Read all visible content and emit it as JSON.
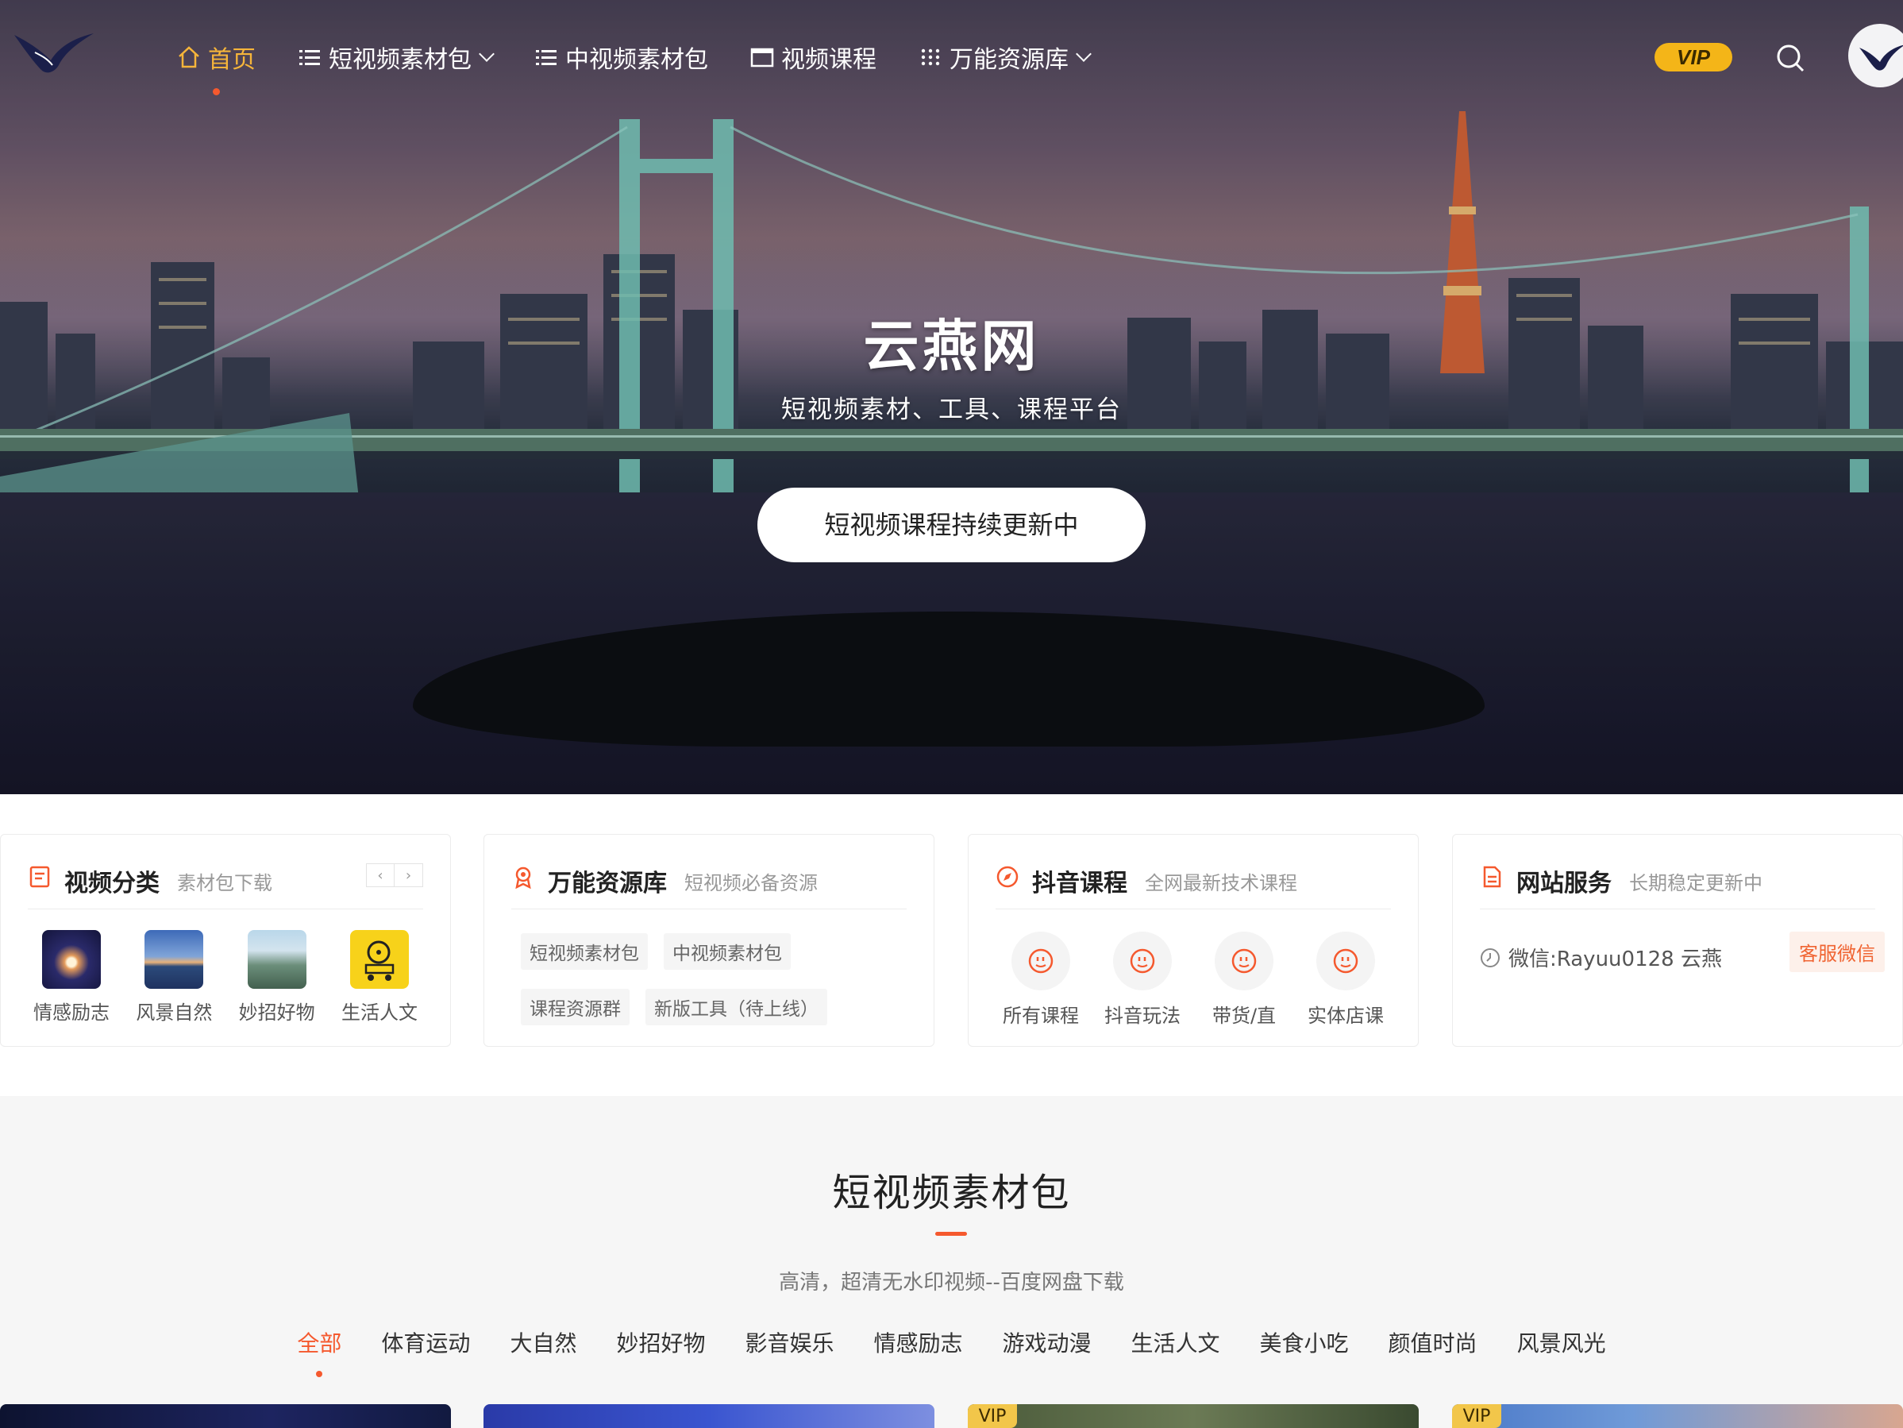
{
  "nav": {
    "items": [
      {
        "label": "首页",
        "active": true,
        "icon": "home-icon"
      },
      {
        "label": "短视频素材包",
        "icon": "list-icon",
        "dropdown": true
      },
      {
        "label": "中视频素材包",
        "icon": "list-icon"
      },
      {
        "label": "视频课程",
        "icon": "window-icon"
      },
      {
        "label": "万能资源库",
        "icon": "grid-icon",
        "dropdown": true
      }
    ],
    "vip_label": "VIP"
  },
  "hero": {
    "title": "云燕网",
    "subtitle": "短视频素材、工具、课程平台",
    "button": "短视频课程持续更新中"
  },
  "cards": {
    "video_category": {
      "title": "视频分类",
      "subtitle": "素材包下载",
      "items": [
        {
          "label": "情感励志"
        },
        {
          "label": "风景自然"
        },
        {
          "label": "妙招好物"
        },
        {
          "label": "生活人文"
        }
      ]
    },
    "resource": {
      "title": "万能资源库",
      "subtitle": "短视频必备资源",
      "tags": [
        "短视频素材包",
        "中视频素材包",
        "课程资源群",
        "新版工具（待上线）"
      ]
    },
    "douyin": {
      "title": "抖音课程",
      "subtitle": "全网最新技术课程",
      "items": [
        {
          "label": "所有课程"
        },
        {
          "label": "抖音玩法"
        },
        {
          "label": "带货/直"
        },
        {
          "label": "实体店课"
        }
      ]
    },
    "service": {
      "title": "网站服务",
      "subtitle": "长期稳定更新中",
      "text": "微信:Rayuu0128 云燕",
      "button": "客服微信"
    }
  },
  "section": {
    "title": "短视频素材包",
    "subtitle": "高清，超清无水印视频--百度网盘下载",
    "filters": [
      "全部",
      "体育运动",
      "大自然",
      "妙招好物",
      "影音娱乐",
      "情感励志",
      "游戏动漫",
      "生活人文",
      "美食小吃",
      "颜值时尚",
      "风景风光"
    ],
    "active_filter": 0,
    "vip_label": "VIP"
  },
  "colors": {
    "accent": "#f5592e",
    "nav_active": "#f6b53a",
    "vip": "#f4b518"
  }
}
